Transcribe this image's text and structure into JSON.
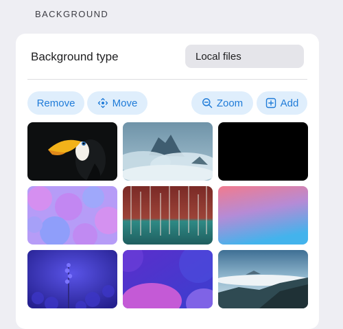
{
  "section": {
    "title": "BACKGROUND"
  },
  "background_type": {
    "label": "Background type",
    "value": "Local files"
  },
  "toolbar": {
    "remove_label": "Remove",
    "move_label": "Move",
    "zoom_label": "Zoom",
    "add_label": "Add"
  },
  "icons": {
    "move": "move-arrows-icon",
    "zoom": "zoom-out-icon",
    "add": "plus-square-icon"
  },
  "colors": {
    "accent": "#1f7bd8",
    "button_bg": "#dfeefc",
    "page_bg": "#eeeef3",
    "card_bg": "#ffffff"
  },
  "thumbnails": [
    "toucan",
    "cloudy-mountains",
    "black",
    "purple-blobs",
    "forest-lake",
    "pink-blue-gradient",
    "purple-flowers",
    "purple-waves",
    "mountain-sea-of-clouds"
  ]
}
